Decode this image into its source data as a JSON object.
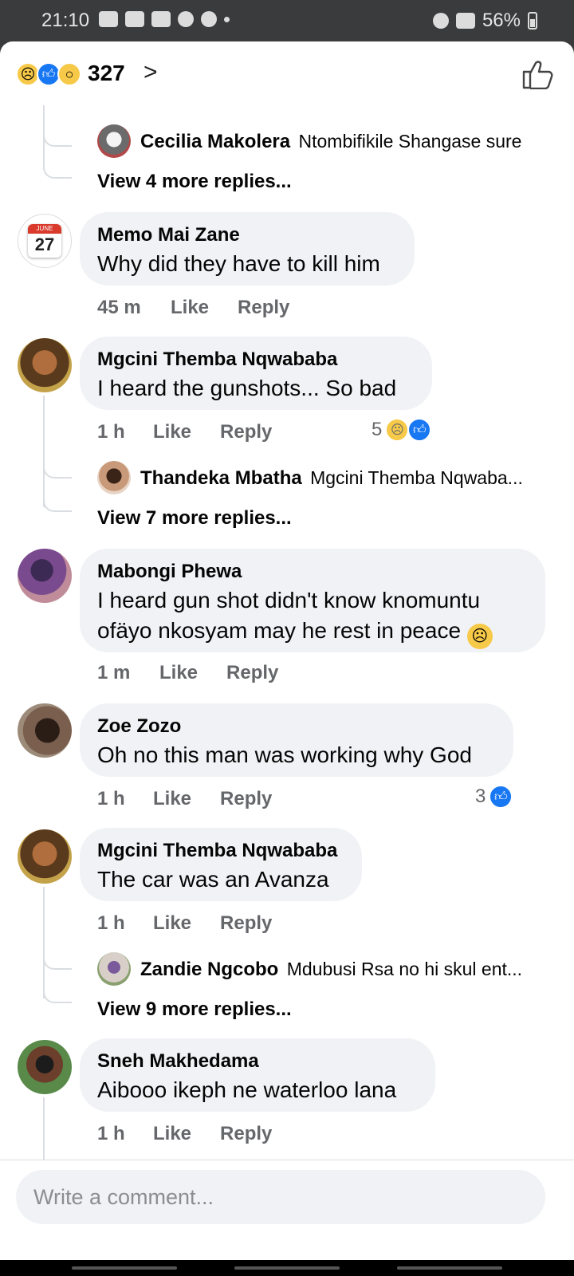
{
  "status_bar": {
    "time": "21:10",
    "battery": "56%"
  },
  "header": {
    "reaction_count": "327",
    "reactions": [
      "sad-emoji",
      "like-emoji",
      "wow-emoji"
    ]
  },
  "thread0": {
    "reply_author": "Cecilia Makolera",
    "reply_text": "Ntombifikile Shangase sure",
    "view_more": "View 4 more replies..."
  },
  "comments": [
    {
      "author": "Memo Mai Zane",
      "text": "Why did they have to kill him",
      "time": "45 m",
      "like": "Like",
      "reply": "Reply",
      "avatar_text": {
        "month": "JUNE",
        "day": "27"
      }
    },
    {
      "author": "Mgcini Themba Nqwababa",
      "text": "I heard the gunshots... So bad",
      "time": "1 h",
      "like": "Like",
      "reply": "Reply",
      "reaction_count": "5",
      "reply_author": "Thandeka Mbatha",
      "reply_text": "Mgcini Themba Nqwaba...",
      "view_more": "View 7 more replies..."
    },
    {
      "author": "Mabongi Phewa",
      "text_line1": "I heard gun shot didn't know knomuntu",
      "text_line2": "ofäyo nkosyam may he rest in peace",
      "time": "1 m",
      "like": "Like",
      "reply": "Reply"
    },
    {
      "author": "Zoe Zozo",
      "text": "Oh no this man was working why God",
      "time": "1 h",
      "like": "Like",
      "reply": "Reply",
      "reaction_count": "3"
    },
    {
      "author": "Mgcini Themba Nqwababa",
      "text": "The car was an Avanza",
      "time": "1 h",
      "like": "Like",
      "reply": "Reply",
      "reply_author": "Zandie Ngcobo",
      "reply_text": "Mdubusi Rsa no hi skul ent...",
      "view_more": "View 9 more replies..."
    },
    {
      "author": "Sneh Makhedama",
      "text": "Aibooo ikeph ne waterloo lana",
      "time": "1 h",
      "like": "Like",
      "reply": "Reply"
    }
  ],
  "composer": {
    "placeholder": "Write a comment..."
  }
}
